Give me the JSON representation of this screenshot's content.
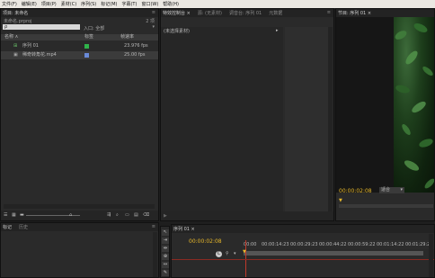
{
  "menubar": [
    "文件(F)",
    "编辑(E)",
    "项目(P)",
    "素材(C)",
    "序列(S)",
    "标记(M)",
    "字幕(T)",
    "窗口(W)",
    "帮助(H)"
  ],
  "project": {
    "tab": "项目: 未命名",
    "file": "未命名.prproj",
    "count": "2 项",
    "in_label": "入口: 全部",
    "columns": {
      "name": "名称 ∧",
      "label": "标签",
      "fps": "帧速率"
    },
    "items": [
      {
        "name": "序列 01",
        "label_color": "#2fb34a",
        "fps": "23.976 fps"
      },
      {
        "name": "稀奇转角花.mp4",
        "label_color": "#6a8ad8",
        "fps": "25.00 fps"
      }
    ]
  },
  "source": {
    "tabs": [
      "特效控制台 ×",
      "源: (无素材)",
      "调音台: 序列 01",
      "元数据"
    ],
    "unselected": "(未选择素材)"
  },
  "program": {
    "tab": "节目: 序列 01 ×",
    "timecode": "00:00:02:08",
    "fit": "适合"
  },
  "history": {
    "tabs": [
      "标记",
      "历史"
    ]
  },
  "timeline": {
    "tab": "序列 01 ×",
    "timecode": "00:00:02:08",
    "ruler": [
      "00:00",
      "00:00:14:23",
      "00:00:29:23",
      "00:00:44:22",
      "00:00:59:22",
      "00:01:14:22",
      "00:01:29:21"
    ]
  },
  "tools": [
    "selection-tool",
    "track-select-tool",
    "ripple-edit-tool",
    "razor-tool",
    "slip-tool",
    "pen-tool"
  ],
  "colors": {
    "accent": "#e8b82a",
    "bg": "#2a2a2a"
  }
}
